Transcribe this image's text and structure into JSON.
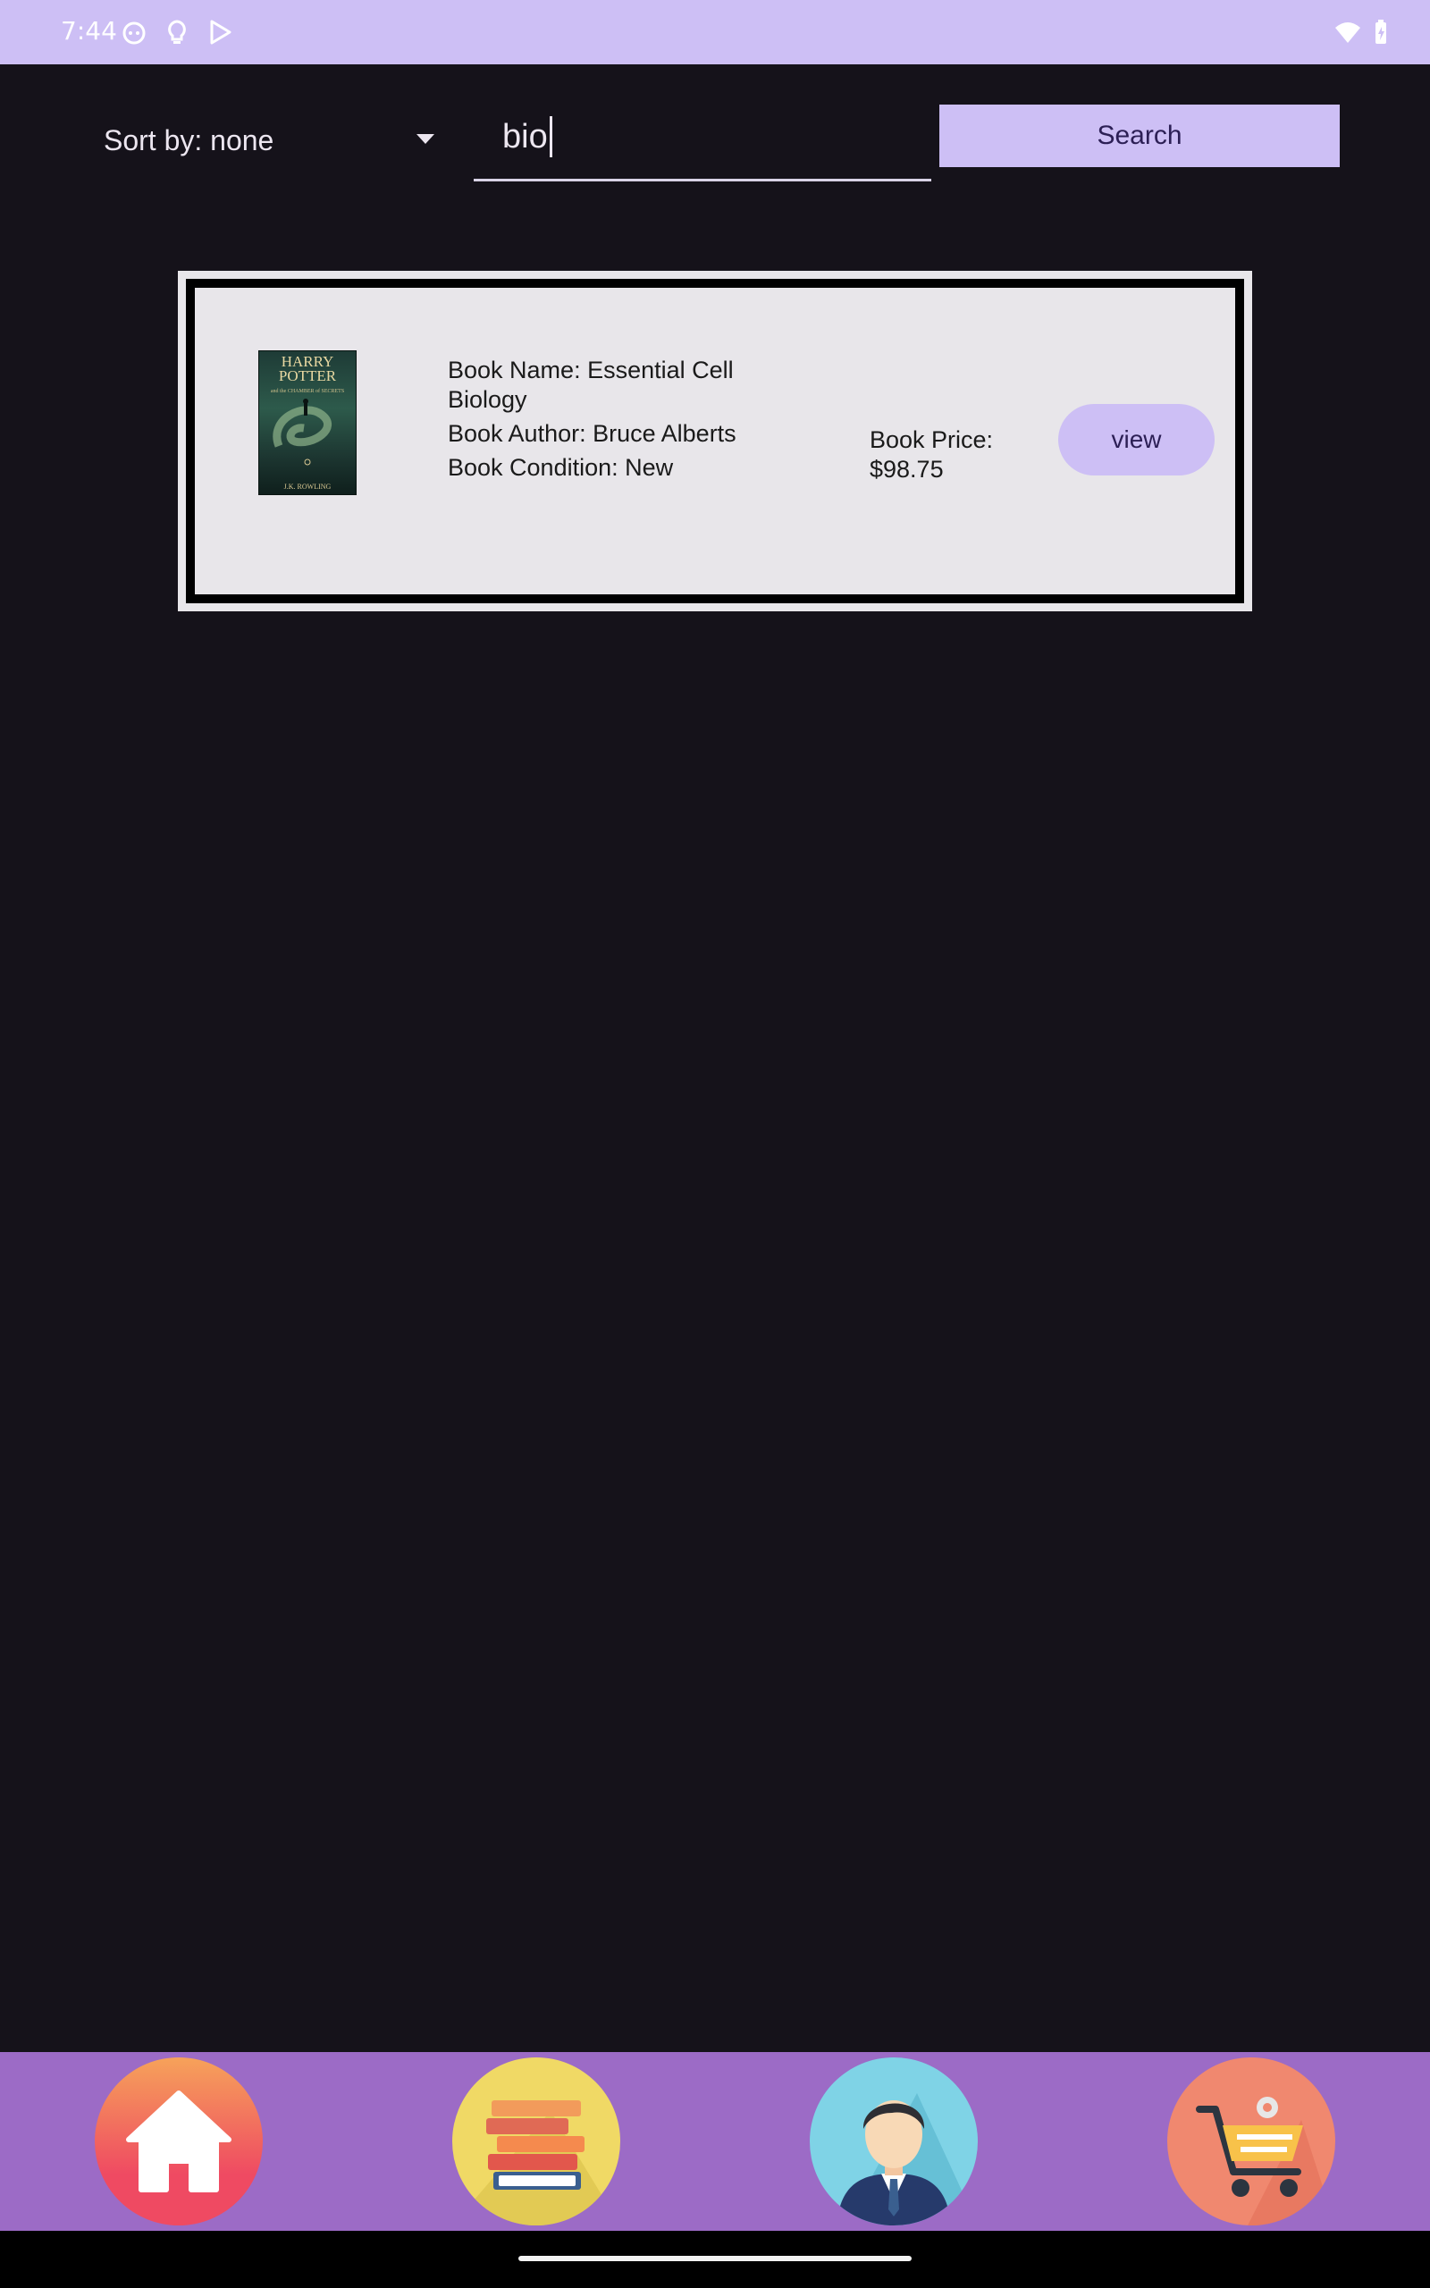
{
  "status_bar": {
    "time": "7:44",
    "left_icons": [
      "face-icon",
      "lightbulb-icon",
      "play-store-icon"
    ],
    "right_icons": [
      "wifi-icon",
      "battery-icon"
    ]
  },
  "toolbar": {
    "sort_label": "Sort by: none",
    "search_value": "bio",
    "search_button_label": "Search"
  },
  "results": [
    {
      "cover_title": "HARRY POTTER",
      "cover_subtitle": "and the CHAMBER of SECRETS",
      "cover_author": "J.K. ROWLING",
      "name_line": "Book Name: Essential Cell Biology",
      "author_line": "Book Author: Bruce Alberts",
      "condition_line": "Book Condition: New",
      "price_line": "Book Price: $98.75",
      "view_label": "view"
    }
  ],
  "bottom_nav": {
    "items": [
      {
        "icon": "home-icon",
        "color": "#ef4a62"
      },
      {
        "icon": "books-icon",
        "color": "#f0d965"
      },
      {
        "icon": "profile-icon",
        "color": "#7fd3e6"
      },
      {
        "icon": "cart-icon",
        "color": "#f0886f"
      }
    ]
  },
  "colors": {
    "background": "#15121a",
    "accent": "#cdbff5",
    "nav_bar": "#9c6bc6",
    "card": "#e8e6ea"
  }
}
